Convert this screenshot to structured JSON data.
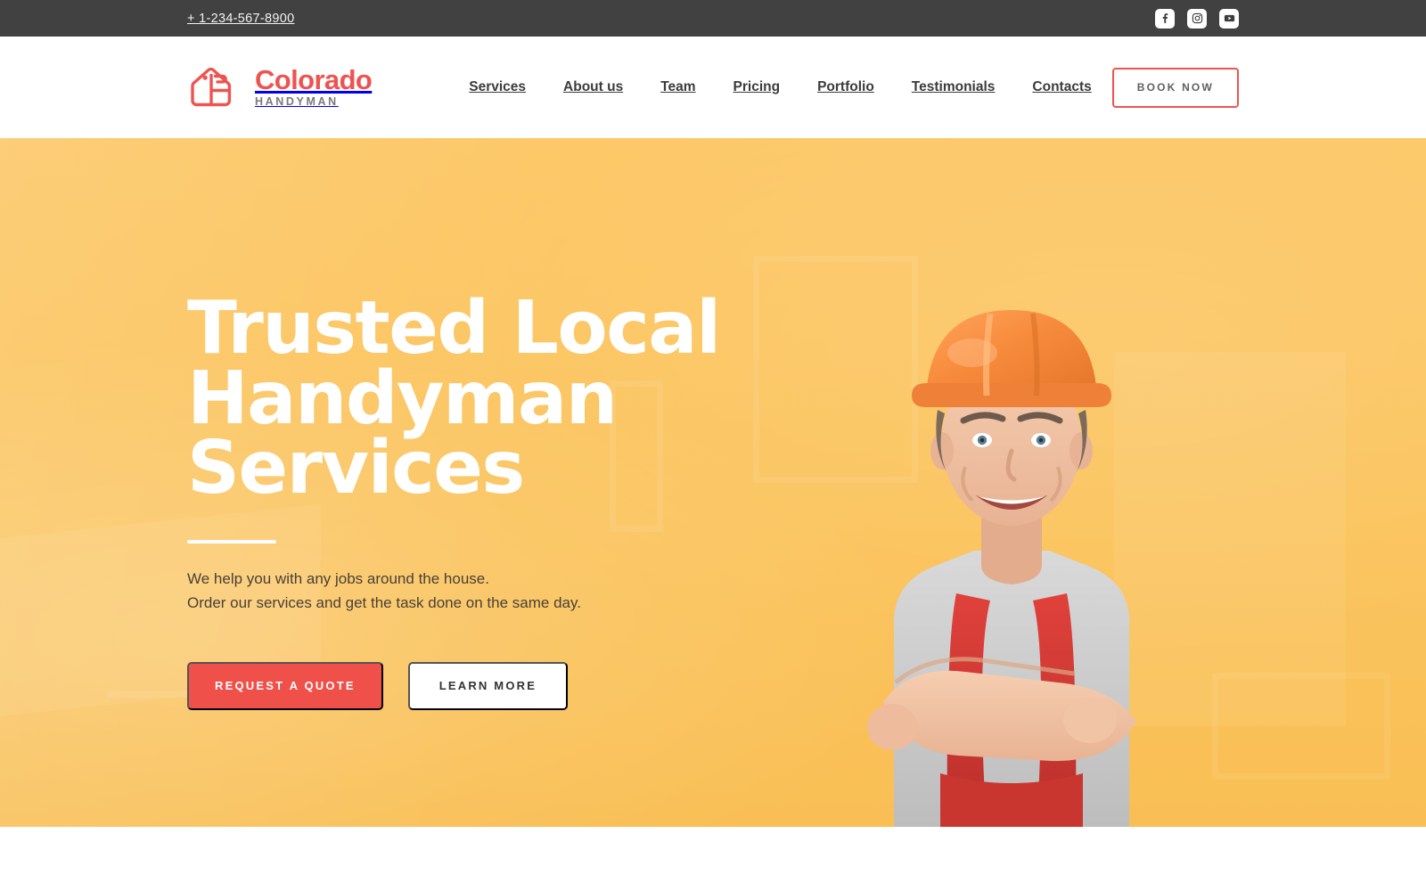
{
  "topbar": {
    "phone": "+ 1-234-567-8900",
    "socials": [
      {
        "name": "facebook",
        "label": "Facebook"
      },
      {
        "name": "instagram",
        "label": "Instagram"
      },
      {
        "name": "youtube",
        "label": "YouTube"
      }
    ]
  },
  "header": {
    "logo": {
      "title": "Colorado",
      "subtitle": "HANDYMAN",
      "icon": "toolbox-icon"
    },
    "nav": [
      {
        "label": "Services"
      },
      {
        "label": "About us"
      },
      {
        "label": "Team"
      },
      {
        "label": "Pricing"
      },
      {
        "label": "Portfolio"
      },
      {
        "label": "Testimonials"
      },
      {
        "label": "Contacts"
      }
    ],
    "cta": {
      "label": "BOOK NOW"
    }
  },
  "hero": {
    "title_lines": [
      "Trusted Local",
      "Handyman",
      "Services"
    ],
    "subtitle_lines": [
      "We help you with any jobs around the house.",
      "Order our services and get the task done on the same day."
    ],
    "primary_button": "REQUEST A QUOTE",
    "secondary_button": "LEARN MORE",
    "image_alt": "Smiling handyman wearing an orange hard hat, grey t-shirt and red overalls with arms crossed"
  },
  "colors": {
    "accent_coral": "#f0504a",
    "logo_coral": "#ef5350",
    "hero_yellow": "#fbc45e",
    "topbar_dark": "#414141",
    "nav_text": "#3b3b3b",
    "hero_subtitle": "#4a4037",
    "white": "#ffffff"
  }
}
